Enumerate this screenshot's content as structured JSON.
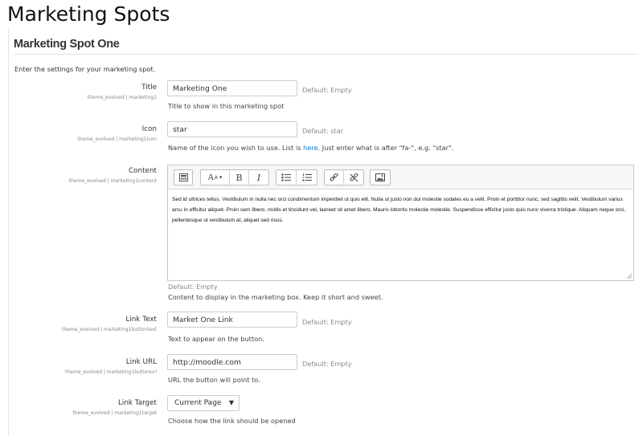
{
  "page": {
    "title": "Marketing Spots"
  },
  "section": {
    "heading": "Marketing Spot One",
    "intro": "Enter the settings for your marketing spot."
  },
  "fields": {
    "title": {
      "label": "Title",
      "setting": "theme_evolved | marketing1",
      "value": "Marketing One",
      "default": "Default: Empty",
      "help": "Title to show in this marketing spot"
    },
    "icon": {
      "label": "Icon",
      "setting": "theme_evolved | marketing1icon",
      "value": "star",
      "default": "Default: star",
      "help_before": "Name of the icon you wish to use. List is ",
      "help_link": "here",
      "help_after": ". Just enter what is after \"fa-\", e.g. \"star\"."
    },
    "content": {
      "label": "Content",
      "setting": "theme_evolved | marketing1content",
      "text": "Sed id ultrices tellus. Vestibulum in nulla nec orci condimentum imperdiet ut quis elit. Nulla ut justo non dui molestie sodales eu a velit. Proin et porttitor nunc, sed sagittis velit. Vestibulum varius arcu in efficitur aliquet. Proin sem libero, mollis et tincidunt vel, laoreet sit amet libero. Mauris lobortis molestie molestie. Suspendisse efficitur justo quis nunc viverra tristique. Aliquam neque orci, pellentesque ut vestibulum at, aliquet sed risus.",
      "default": "Default: Empty",
      "help": "Content to display in the marketing box. Keep it short and sweet.",
      "toolbar": {
        "bold": "B",
        "italic": "I",
        "font_size": "A"
      }
    },
    "link_text": {
      "label": "Link Text",
      "setting": "theme_evolved | marketing1buttontext",
      "value": "Market One Link",
      "default": "Default: Empty",
      "help": "Text to appear on the button."
    },
    "link_url": {
      "label": "Link URL",
      "setting": "theme_evolved | marketing1buttonurl",
      "value": "http://moodle.com",
      "default": "Default: Empty",
      "help": "URL the button will point to."
    },
    "link_target": {
      "label": "Link Target",
      "setting": "theme_evolved | marketing1target",
      "value": "Current Page",
      "help": "Choose how the link should be opened"
    }
  },
  "colors": {
    "link": "#1177d1",
    "border": "#cccccc",
    "muted": "#8a8a8a"
  }
}
